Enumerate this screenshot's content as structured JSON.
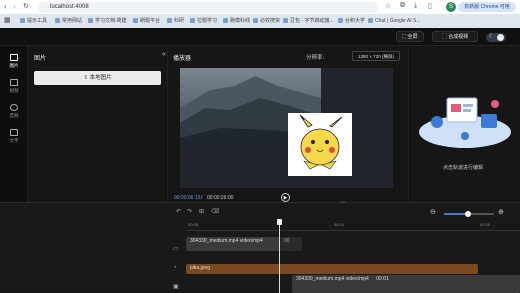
{
  "browser": {
    "url": "localhost:4008",
    "profile_initial": "S",
    "update_label": "有新版 Chrome 可用",
    "bookmarks": [
      "提示工具",
      "常用网站",
      "学习文档-简建",
      "刷题平台",
      "科研",
      "拉题学习",
      "跑模科线",
      "必收搜资",
      "豆包 - 字节跳动旗...",
      "台积大学",
      "Chat | Google AI S..."
    ]
  },
  "app": {
    "fullscreen_label": "全屏",
    "export_label": "合成视频",
    "nav": [
      {
        "label": "图片",
        "icon": "image-icon"
      },
      {
        "label": "视频",
        "icon": "video-icon"
      },
      {
        "label": "音频",
        "icon": "audio-icon"
      },
      {
        "label": "文字",
        "icon": "text-icon"
      }
    ],
    "panel_title": "图片",
    "upload_label": "本地图片",
    "player_title": "播放器",
    "resolution_label": "分辨率:",
    "resolution_value": "1280 × 720 (横屏)",
    "time_current": "00:00:06:15",
    "time_separator": "/",
    "time_total": "00:00:26:00",
    "right_hint": "点击轨道进行编辑",
    "timeline": {
      "ruler_ticks": [
        "00:00",
        "00:10",
        "00:20"
      ],
      "tracks": [
        {
          "label": "304330_medium.mp4 video/mp4",
          "extra": "00"
        },
        {
          "label": "pika.jpeg"
        },
        {
          "label": "304330_medium.mp4 video/mp4",
          "extra": "00:01"
        }
      ]
    }
  },
  "colors": {
    "accent": "#3a7bd5",
    "track_video": "#3a3a3a",
    "track_image": "#7a4a1e",
    "pikachu_yellow": "#f5d94a"
  }
}
